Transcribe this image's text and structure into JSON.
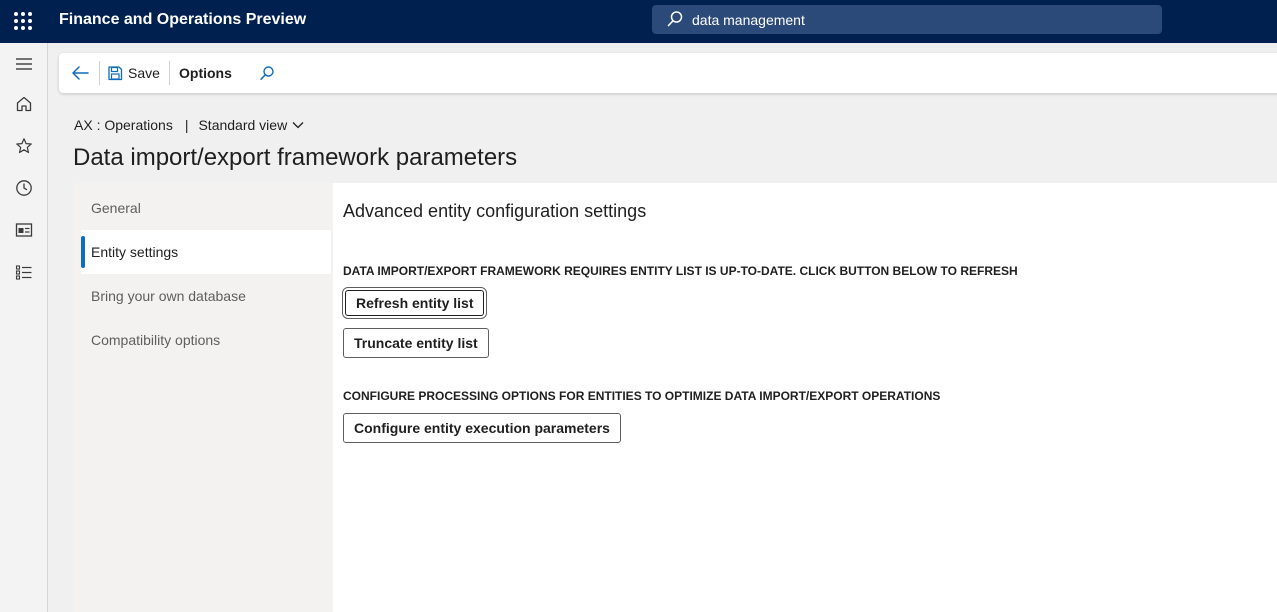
{
  "topbar": {
    "app_title": "Finance and Operations Preview",
    "search_value": "data management"
  },
  "navrail": {
    "items": [
      "menu-icon",
      "home-icon",
      "star-icon",
      "clock-icon",
      "workspace-icon",
      "list-icon"
    ]
  },
  "actionbar": {
    "save_label": "Save",
    "options_label": "Options"
  },
  "breadcrumb": {
    "company": "AX : Operations",
    "separator": "|",
    "view": "Standard view"
  },
  "page_title": "Data import/export framework parameters",
  "tabs": [
    {
      "label": "General"
    },
    {
      "label": "Entity settings",
      "active": true
    },
    {
      "label": "Bring your own database"
    },
    {
      "label": "Compatibility options"
    }
  ],
  "panel": {
    "heading": "Advanced entity configuration settings",
    "section1_label": "DATA IMPORT/EXPORT FRAMEWORK REQUIRES ENTITY LIST IS UP-TO-DATE. CLICK BUTTON BELOW TO REFRESH",
    "refresh_button": "Refresh entity list",
    "truncate_button": "Truncate entity list",
    "section2_label": "CONFIGURE PROCESSING OPTIONS FOR ENTITIES TO OPTIMIZE DATA IMPORT/EXPORT OPERATIONS",
    "configure_button": "Configure entity execution parameters"
  },
  "colors": {
    "topbar": "#002050",
    "accent": "#0f6cbd"
  }
}
